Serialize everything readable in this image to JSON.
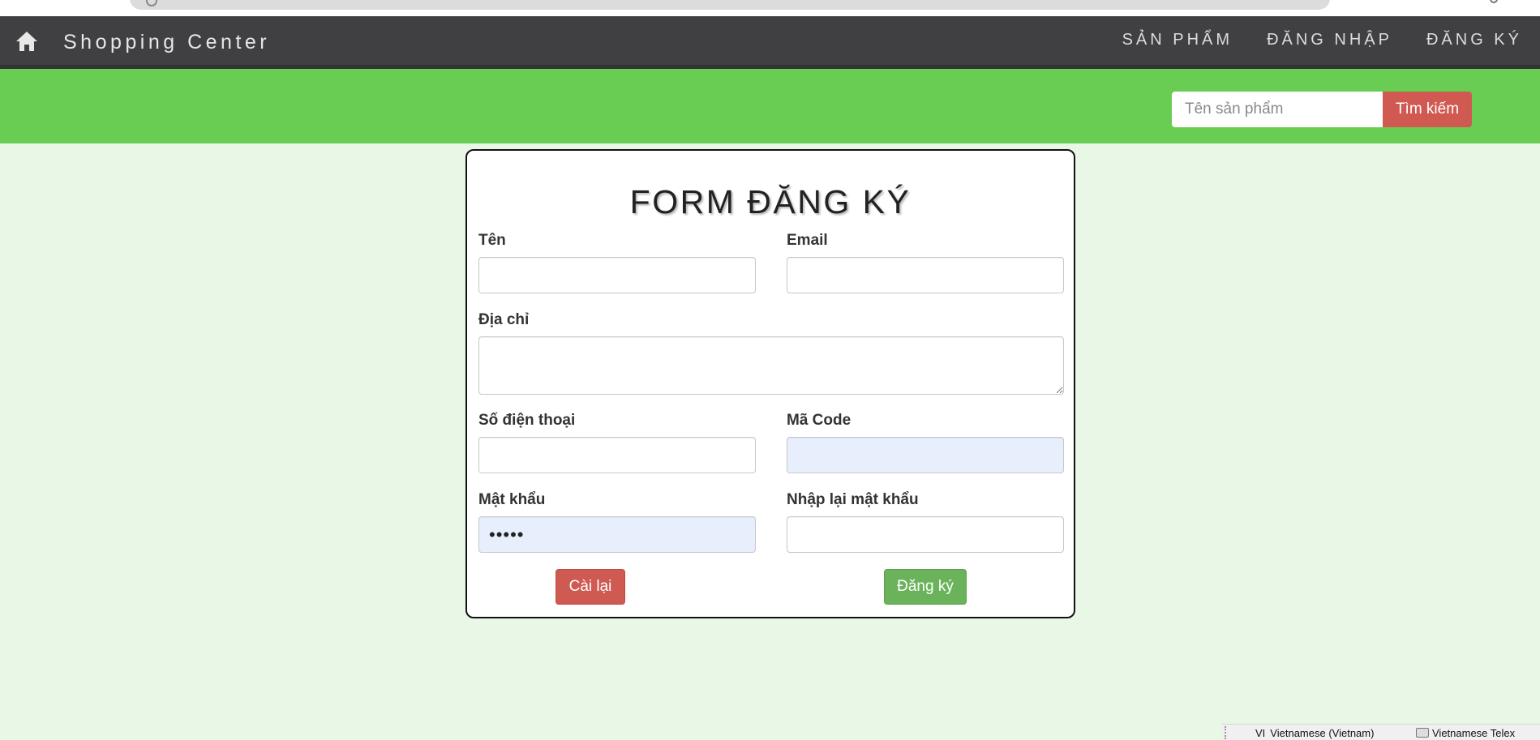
{
  "navbar": {
    "home_icon": "home-icon",
    "brand": "Shopping Center",
    "links": [
      "SẢN PHẨM",
      "ĐĂNG NHẬP",
      "ĐĂNG KÝ"
    ]
  },
  "search": {
    "placeholder": "Tên sản phẩm",
    "value": "",
    "button_label": "Tìm kiếm"
  },
  "form": {
    "title": "FORM ĐĂNG KÝ",
    "fields": {
      "name": {
        "label": "Tên",
        "value": ""
      },
      "email": {
        "label": "Email",
        "value": ""
      },
      "address": {
        "label": "Địa chỉ",
        "value": ""
      },
      "phone": {
        "label": "Số điện thoại",
        "value": ""
      },
      "code": {
        "label": "Mã Code",
        "value": ""
      },
      "password": {
        "label": "Mật khẩu",
        "value": "•••••"
      },
      "confirm_password": {
        "label": "Nhập lại mật khẩu",
        "value": ""
      }
    },
    "reset_label": "Cài lại",
    "submit_label": "Đăng ký"
  },
  "ime": {
    "lang_code": "VI",
    "language": "Vietnamese (Vietnam)",
    "input_method": "Vietnamese Telex"
  },
  "colors": {
    "navbar_bg": "#404042",
    "search_bar_bg": "#6acd53",
    "page_bg": "#e8f7e6",
    "danger": "#cf5a52",
    "success": "#6ab35a"
  }
}
